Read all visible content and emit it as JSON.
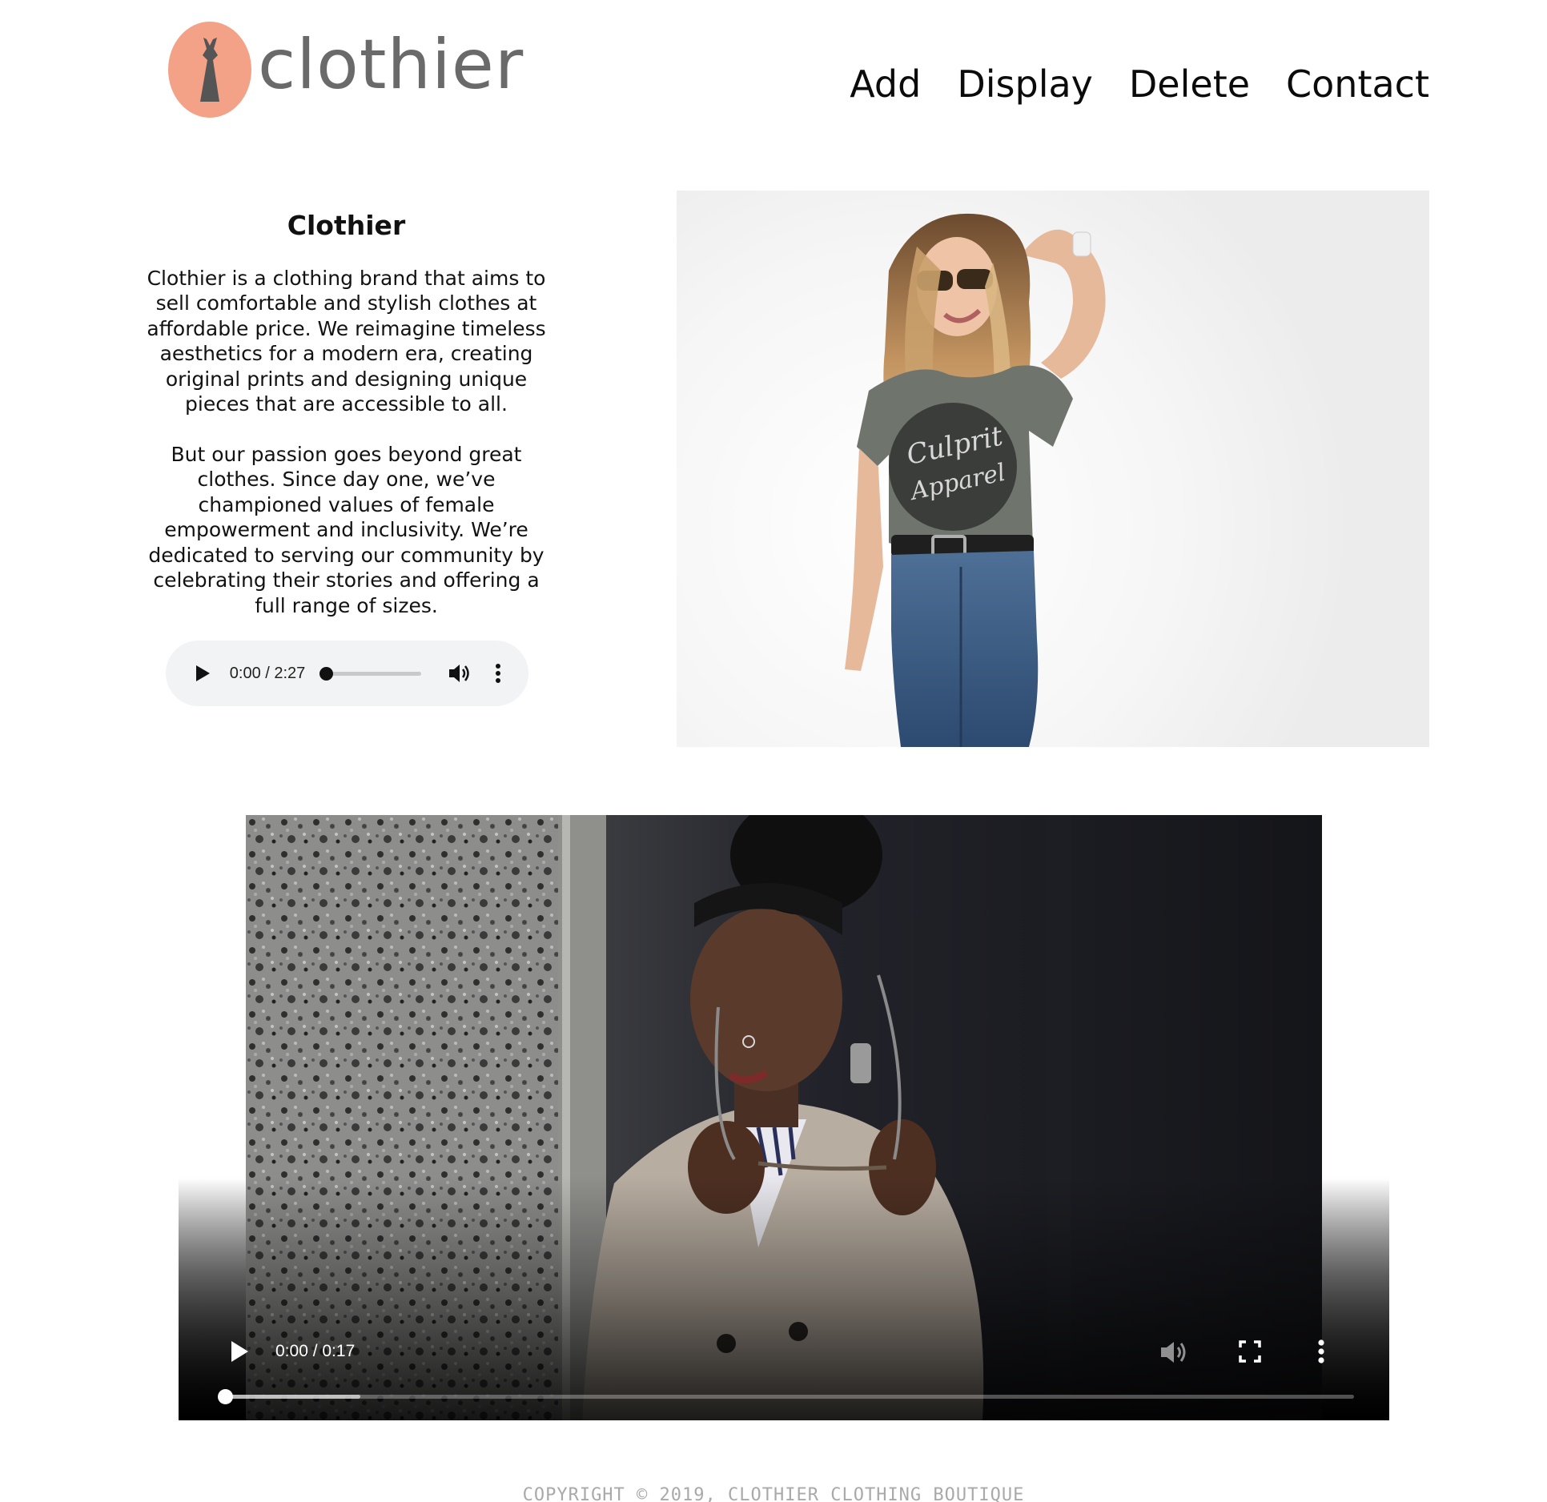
{
  "brand": {
    "name": "clothier",
    "logo_icon": "dress-icon",
    "logo_color": "#f4a287"
  },
  "nav": {
    "add": "Add",
    "display": "Display",
    "delete": "Delete",
    "contact": "Contact"
  },
  "intro": {
    "title": "Clothier",
    "paragraph1": "Clothier is a clothing brand that aims to sell comfortable and stylish clothes at affordable price. We reimagine timeless aesthetics for a modern era, creating original prints and designing unique pieces that are accessible to all.",
    "paragraph2": "But our passion goes beyond great clothes. Since day one, we’ve championed values of female empowerment and inclusivity. We’re dedicated to serving our community by celebrating their stories and offering a full range of sizes."
  },
  "audio": {
    "time": "0:00 / 2:27",
    "progress": 0
  },
  "hero_image": {
    "shirt_text_1": "Culprit",
    "shirt_text_2": "Apparel"
  },
  "video": {
    "time": "0:00 / 0:17",
    "progress": 0,
    "buffered": 0.12
  },
  "footer": {
    "copyright": "COPYRIGHT © 2019, CLOTHIER CLOTHING BOUTIQUE"
  },
  "colors": {
    "audio_bg": "#f1f3f4",
    "footer_text": "#a9a9a9",
    "nav_text": "#0b0b0b"
  }
}
